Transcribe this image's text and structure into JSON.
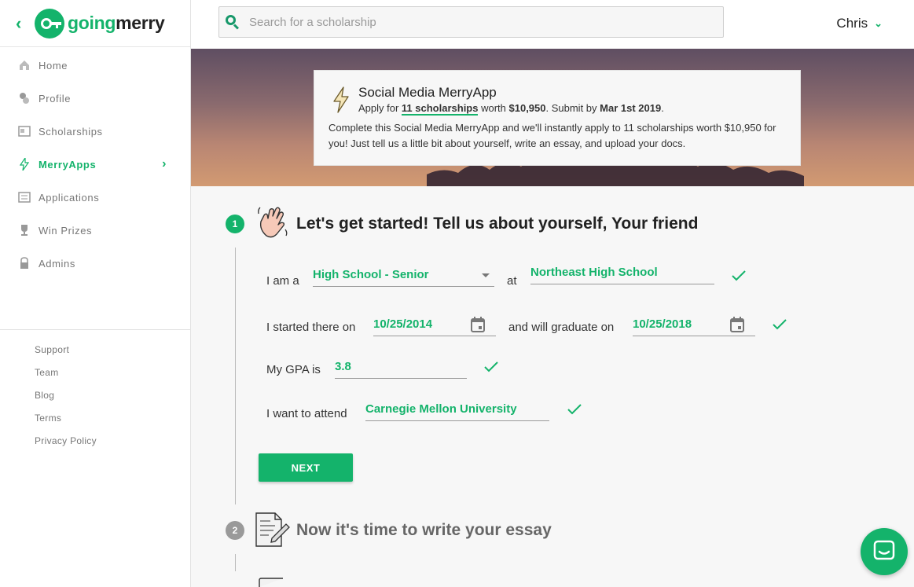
{
  "brand": {
    "part1": "going",
    "part2": "merry"
  },
  "sidebar": {
    "items": [
      {
        "label": "Home",
        "icon": "home-icon"
      },
      {
        "label": "Profile",
        "icon": "profile-icon"
      },
      {
        "label": "Scholarships",
        "icon": "scholarships-icon"
      },
      {
        "label": "MerryApps",
        "icon": "lightning-icon",
        "active": true
      },
      {
        "label": "Applications",
        "icon": "applications-icon"
      },
      {
        "label": "Win Prizes",
        "icon": "trophy-icon"
      },
      {
        "label": "Admins",
        "icon": "lock-icon"
      }
    ],
    "footer_links": [
      "Support",
      "Team",
      "Blog",
      "Terms",
      "Privacy Policy"
    ]
  },
  "topbar": {
    "search_placeholder": "Search for a scholarship",
    "user_name": "Chris"
  },
  "hero": {
    "card_title": "Social Media MerryApp",
    "sub_prefix": "Apply for ",
    "sub_count": "11 scholarships",
    "sub_worth": " worth ",
    "sub_amount": "$10,950",
    "sub_submit": ". Submit by ",
    "sub_deadline": "Mar 1st 2019",
    "sub_end": ".",
    "description": "Complete this Social Media MerryApp and we'll instantly apply to 11 scholarships worth $10,950 for you! Just tell us a little bit about yourself, write an essay, and upload your docs."
  },
  "steps": [
    {
      "number": "1",
      "title": "Let's get started! Tell us about yourself, Your friend"
    },
    {
      "number": "2",
      "title": "Now it's time to write your essay"
    }
  ],
  "form": {
    "i_am_a": "I am a",
    "grade_value": "High School - Senior",
    "at": "at",
    "school_value": "Northeast High School",
    "started_label": "I started there on",
    "start_date": "10/25/2014",
    "graduate_label": "and will graduate on",
    "grad_date": "10/25/2018",
    "gpa_label": "My GPA is",
    "gpa_value": "3.8",
    "attend_label": "I want to attend",
    "attend_value": "Carnegie Mellon University",
    "next_label": "NEXT"
  },
  "colors": {
    "accent": "#14b36b",
    "step_inactive": "#9a9a9a"
  }
}
